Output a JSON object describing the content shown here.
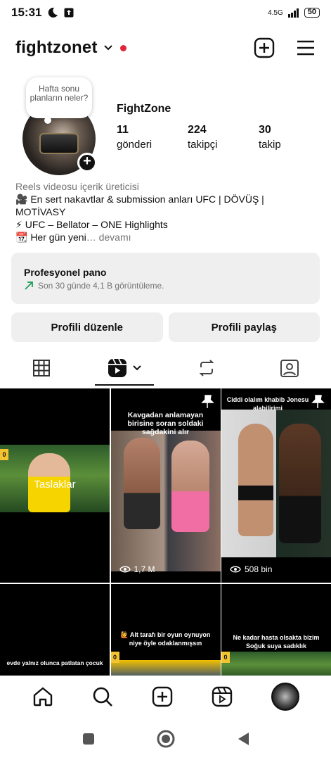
{
  "status_bar": {
    "time": "15:31",
    "network": "4.5G",
    "battery": "50"
  },
  "header": {
    "username": "fightzonet"
  },
  "profile": {
    "note": "Hafta sonu planların neler?",
    "display_name": "FightZone",
    "stats": [
      {
        "value": "11",
        "label": "gönderi"
      },
      {
        "value": "224",
        "label": "takipçi"
      },
      {
        "value": "30",
        "label": "takip"
      }
    ]
  },
  "bio": {
    "category": "Reels videosu içerik üreticisi",
    "line1": "🎥 En sert nakavtlar & submission anları  UFC  |  DÖVÜŞ  |  MOTİVASY",
    "line2": "⚡ UFC – Bellator – ONE Highlights",
    "line3": "📆 Her gün yeni",
    "more": "… devamı"
  },
  "pano": {
    "title": "Profesyonel pano",
    "subtitle": "Son 30 günde 4,1 B görüntüleme."
  },
  "buttons": {
    "edit": "Profili düzenle",
    "share": "Profili paylaş"
  },
  "grid": {
    "drafts_label": "Taslaklar",
    "post2_caption": "Kavgadan anlamayan birisine soran soldaki sağdakini alır",
    "post2_views": "1,7 M",
    "post3_caption": "Ciddi olalım khabib Jonesu alabilirimi",
    "post3_views": "508 bin",
    "post4_caption": "evde yalnız olunca patlatan çocuk",
    "post5_caption": "🙋 Alt tarafı bir oyun oynuyon niye öyle odaklanmışsın",
    "post6_caption": "Ne kadar hasta olsakta bizim Soğuk suya sadıklık"
  },
  "colors": {
    "live_dot": "#e0243b",
    "pano_bg": "#efefef",
    "trend_arrow": "#1f9d55"
  }
}
